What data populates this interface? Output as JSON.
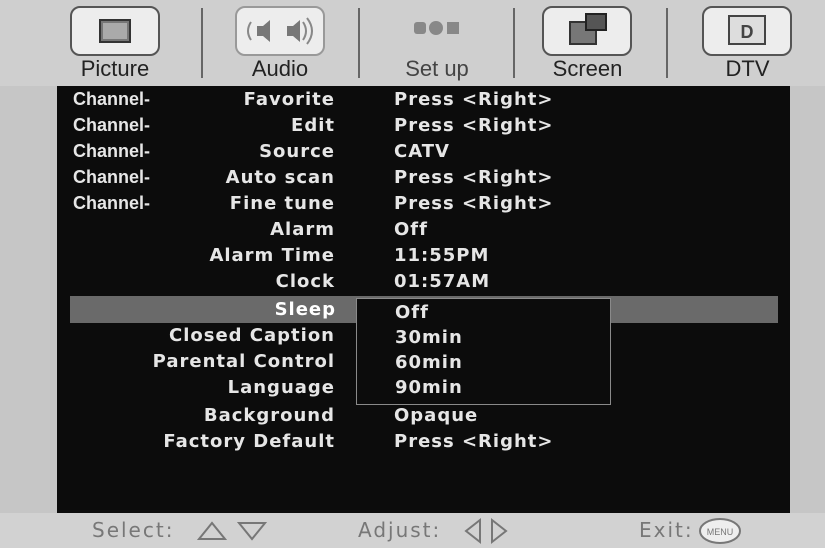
{
  "tabs": [
    {
      "label": "Picture",
      "icon": "picture-icon"
    },
    {
      "label": "Audio",
      "icon": "speaker-icon"
    },
    {
      "label": "Set up",
      "icon": "setup-icon",
      "active": true
    },
    {
      "label": "Screen",
      "icon": "screen-icon"
    },
    {
      "label": "DTV",
      "icon": "dtv-icon",
      "icon_text": "D"
    }
  ],
  "menu": [
    {
      "prefix": "Channel-",
      "label": "Favorite",
      "value": "Press <Right>"
    },
    {
      "prefix": "Channel-",
      "label": "Edit",
      "value": "Press <Right>"
    },
    {
      "prefix": "Channel-",
      "label": "Source",
      "value": "CATV"
    },
    {
      "prefix": "Channel-",
      "label": "Auto scan",
      "value": "Press <Right>"
    },
    {
      "prefix": "Channel-",
      "label": "Fine tune",
      "value": "Press <Right>"
    },
    {
      "label": "Alarm",
      "value": "Off"
    },
    {
      "label": "Alarm Time",
      "value": "11:55PM"
    },
    {
      "label": "Clock",
      "value": "01:57AM"
    },
    {
      "label": "Sleep",
      "value": "",
      "selected": true
    },
    {
      "label": "Closed Caption",
      "value": ""
    },
    {
      "label": "Parental Control",
      "value": ""
    },
    {
      "label": "Language",
      "value": ""
    },
    {
      "label": "Background",
      "value": "Opaque"
    },
    {
      "label": "Factory Default",
      "value": "Press <Right>"
    }
  ],
  "sleep_options": [
    "Off",
    "30min",
    "60min",
    "90min"
  ],
  "footer": {
    "select_label": "Select:",
    "adjust_label": "Adjust:",
    "exit_label": "Exit:",
    "menu_button_text": "MENU"
  }
}
